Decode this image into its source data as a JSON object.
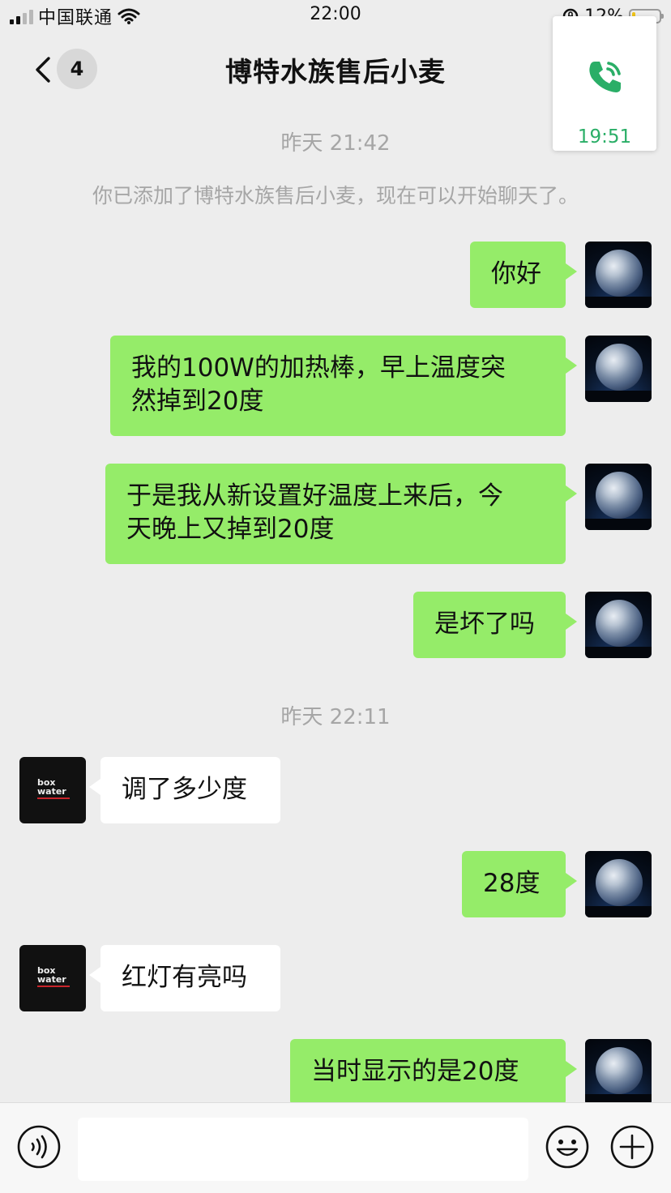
{
  "status_bar": {
    "carrier": "中国联通",
    "time": "22:00",
    "battery_percent": "12%",
    "battery_level": 0.12
  },
  "nav": {
    "unread_count": "4",
    "title": "博特水族售后小麦"
  },
  "call_card": {
    "duration": "19:51",
    "accent": "#2aae67"
  },
  "timestamps": [
    "昨天 21:42",
    "昨天 22:11"
  ],
  "system_message": "你已添加了博特水族售后小麦，现在可以开始聊天了。",
  "messages": [
    {
      "from": "me",
      "text": "你好"
    },
    {
      "from": "me",
      "text": "我的100W的加热棒，早上温度突\n然掉到20度"
    },
    {
      "from": "me",
      "text": "于是我从新设置好温度上来后，今\n天晚上又掉到20度"
    },
    {
      "from": "me",
      "text": "是坏了吗"
    },
    {
      "from": "other",
      "text": "调了多少度"
    },
    {
      "from": "me",
      "text": "28度"
    },
    {
      "from": "other",
      "text": "红灯有亮吗"
    },
    {
      "from": "me",
      "text": "当时显示的是20度"
    }
  ],
  "other_avatar_logo": "box\nwater",
  "colors": {
    "my_bubble": "#95ec69",
    "other_bubble": "#ffffff",
    "background": "#ededed"
  },
  "input": {
    "value": "",
    "icons": [
      "voice-icon",
      "emoji-icon",
      "plus-icon"
    ]
  }
}
